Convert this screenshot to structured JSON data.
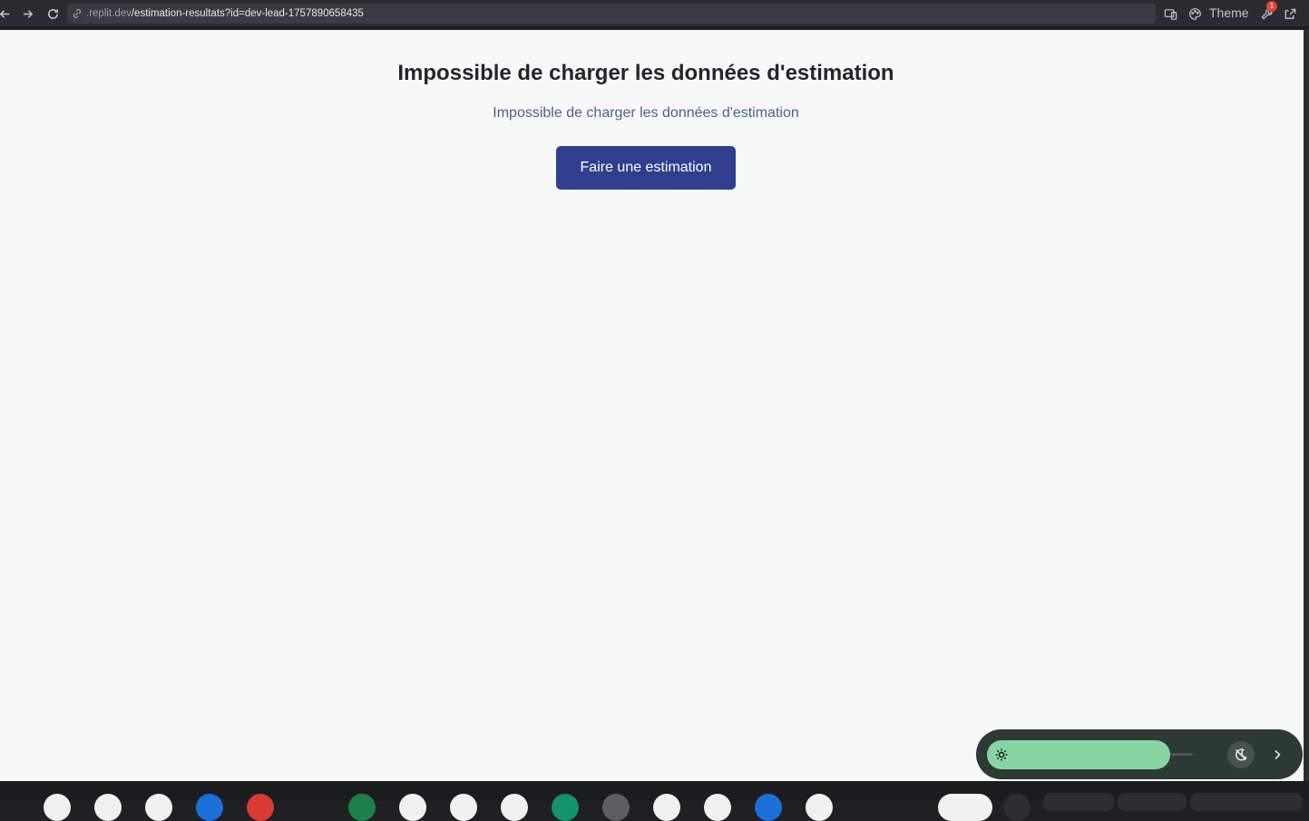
{
  "browser": {
    "url_domain": ".replit.dev",
    "url_path": "/estimation-resultats?id=dev-lead-1757890658435",
    "theme_label": "Theme",
    "notification_count": "1"
  },
  "page": {
    "heading": "Impossible de charger les données d'estimation",
    "message": "Impossible de charger les données d'estimation",
    "cta_label": "Faire une estimation"
  },
  "brightness_widget": {
    "level": 0.89
  },
  "colors": {
    "cta_background": "#2f3f8e",
    "message_text": "#4a5f93",
    "slider_fill": "#88d5a4"
  }
}
